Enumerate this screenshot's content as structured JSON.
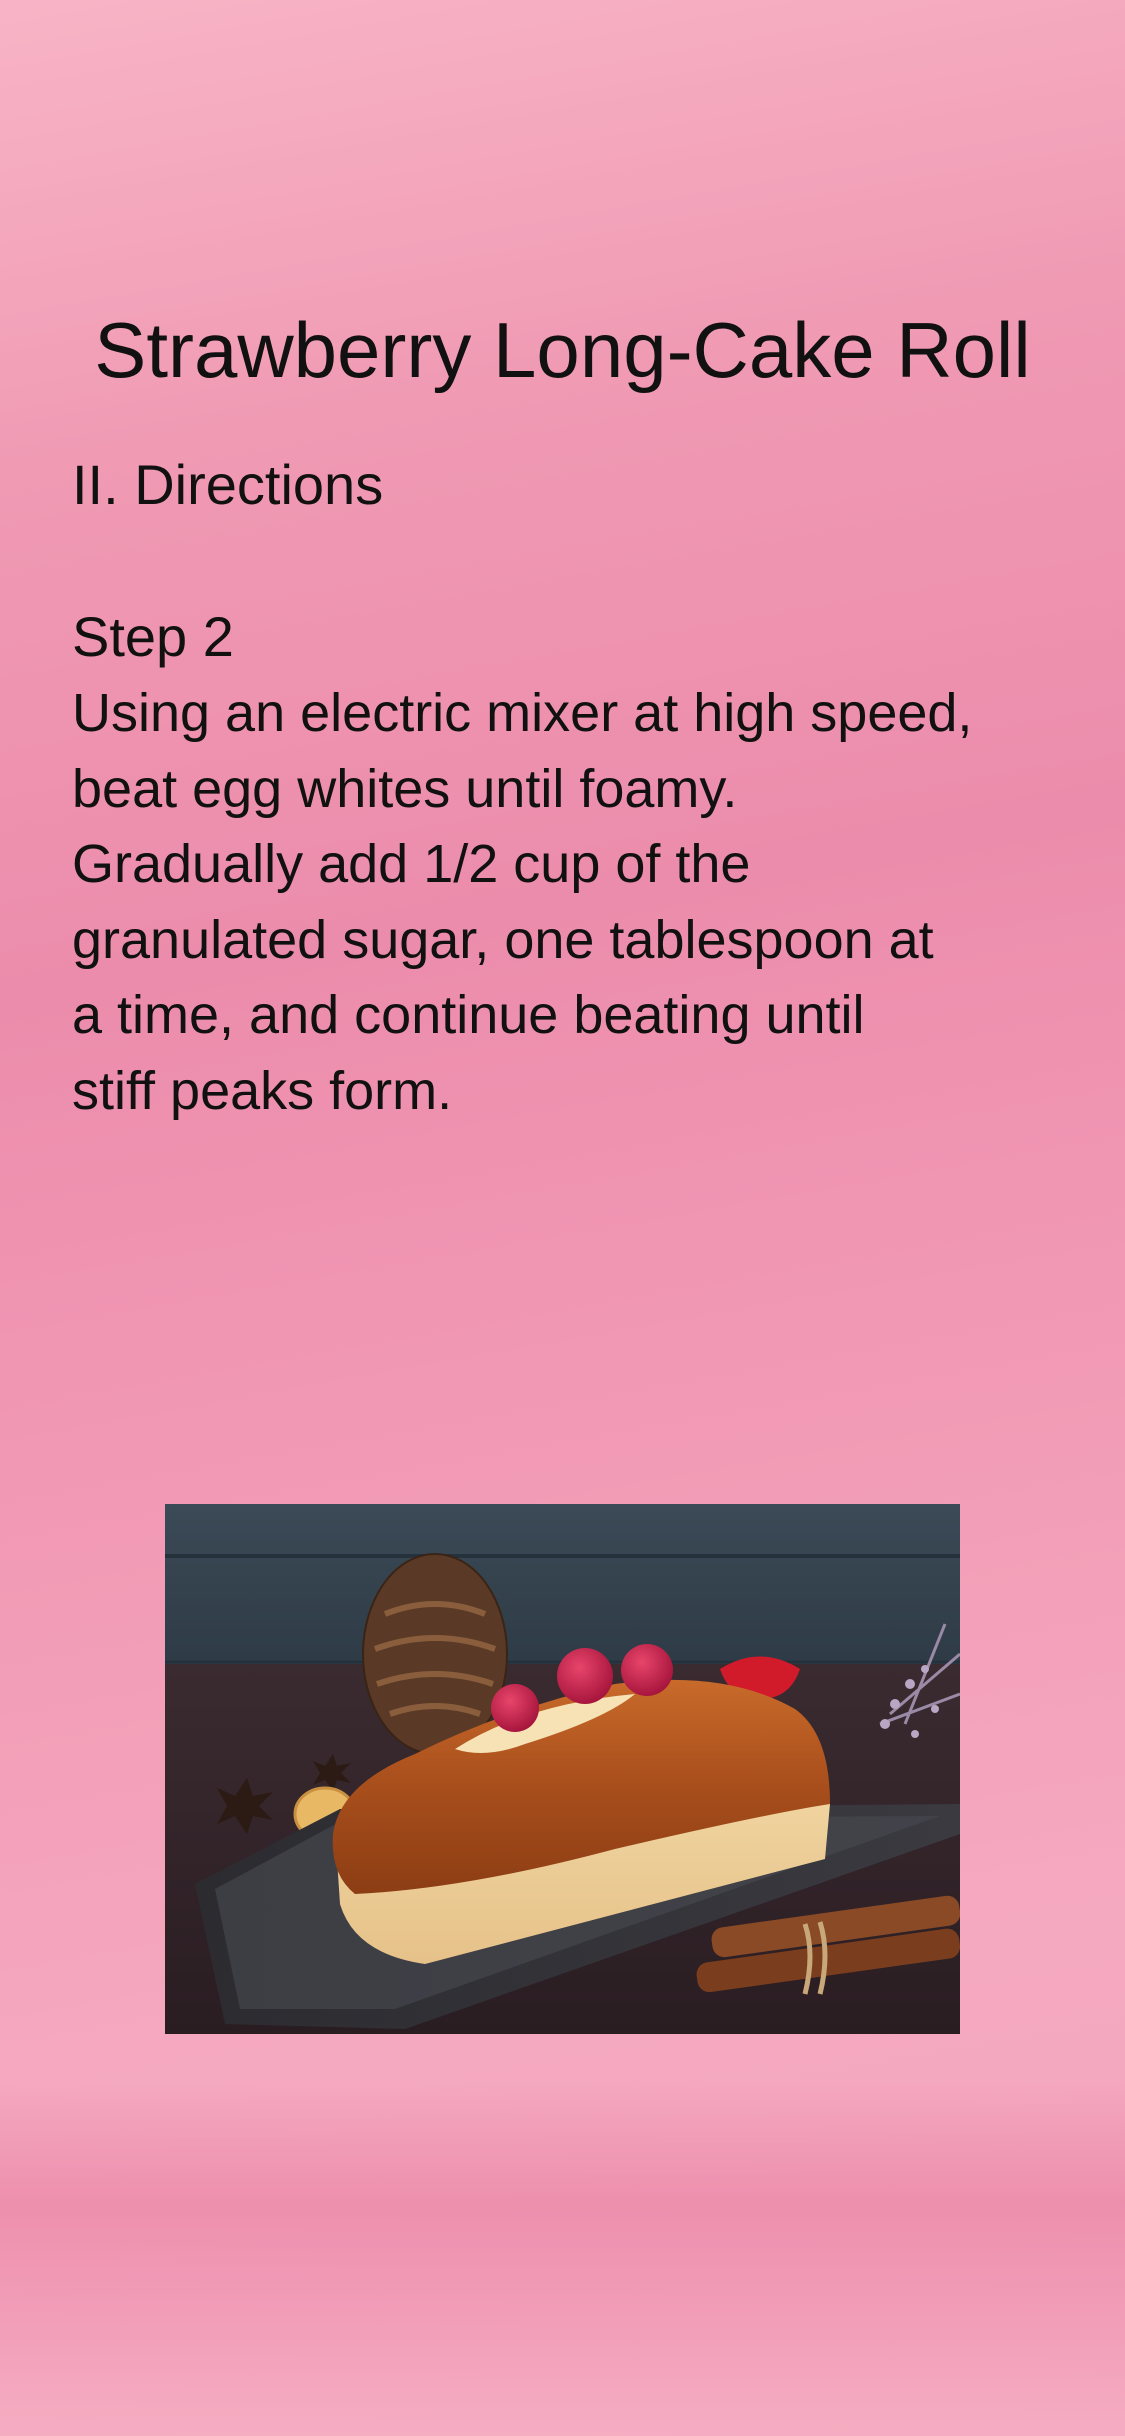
{
  "recipe": {
    "title": "Strawberry Long-Cake Roll",
    "section": "II. Directions",
    "step": {
      "label": "Step 2",
      "text": "Using an electric mixer at high speed,\nbeat egg whites until foamy.\nGradually add 1/2 cup of the\ngranulated sugar, one tablespoon at\na time, and continue beating until\nstiff peaks form."
    }
  },
  "image": {
    "subject": "loaf-cake-photo"
  },
  "colors": {
    "background_top": "#f8b4c6",
    "background_mid": "#ec8cac",
    "text": "#111111"
  }
}
